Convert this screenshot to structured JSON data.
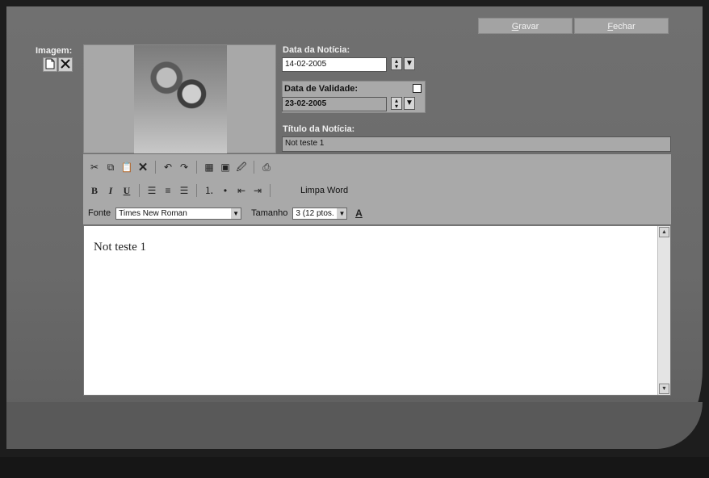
{
  "header": {
    "save_label_first": "G",
    "save_label_rest": "ravar",
    "close_label_first": "F",
    "close_label_rest": "echar"
  },
  "image_section": {
    "label": "Imagem:",
    "new_icon": "document-icon",
    "delete_icon": "close-icon"
  },
  "news_date": {
    "label": "Data da Notícia:",
    "value": "14-02-2005"
  },
  "validity_date": {
    "label": "Data de Validade:",
    "value": "23-02-2005",
    "checked": false
  },
  "news_title": {
    "label": "Título da Notícia:",
    "value": "Not teste 1"
  },
  "toolbar": {
    "clean_word_label": "Limpa Word",
    "font_label": "Fonte",
    "font_value": "Times New Roman",
    "size_label": "Tamanho",
    "size_value": "3 (12 ptos.",
    "bold": "B",
    "italic": "I",
    "underline": "U"
  },
  "editor": {
    "content": "Not teste 1"
  }
}
